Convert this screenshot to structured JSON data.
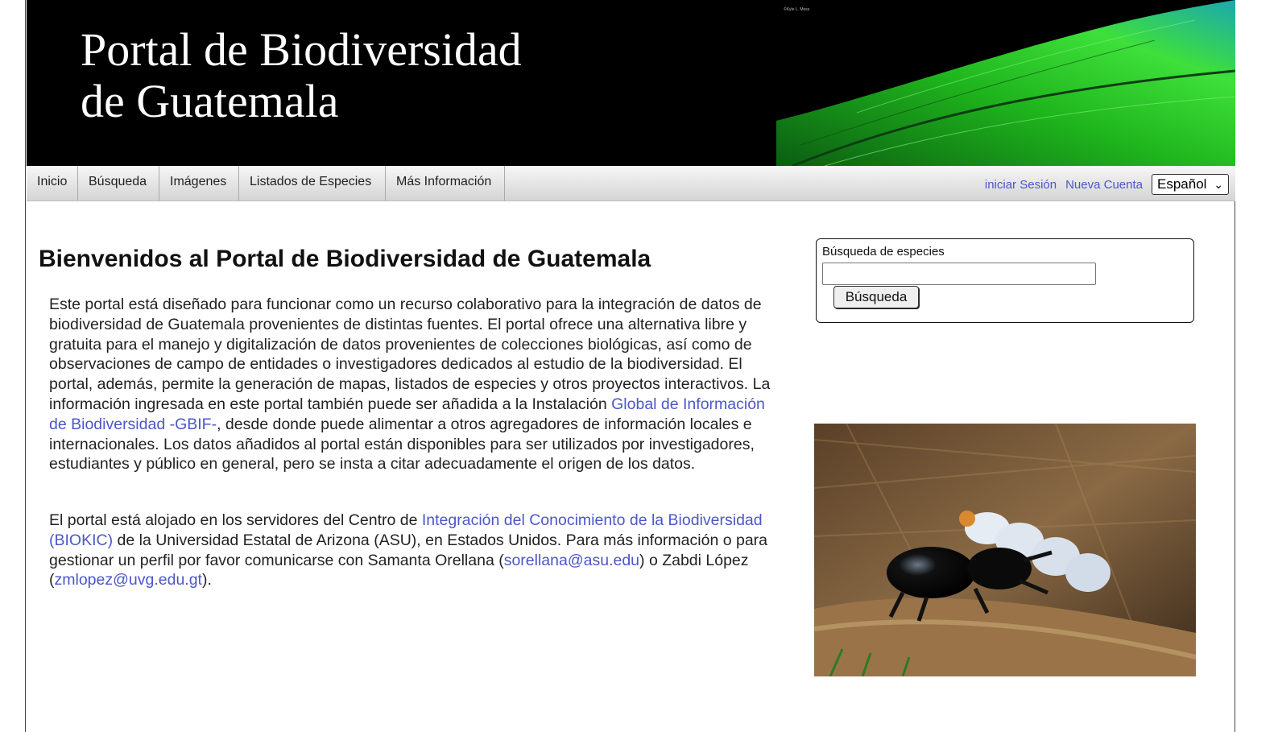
{
  "banner": {
    "title_line1": "Portal de Biodiversidad",
    "title_line2": "de Guatemala",
    "credit": "©Kyle L. Moss"
  },
  "nav": {
    "items": [
      {
        "label": "Inicio"
      },
      {
        "label": "Búsqueda"
      },
      {
        "label": "Imágenes"
      },
      {
        "label": "Listados de Especies"
      },
      {
        "label": "Más Información"
      }
    ],
    "login": "iniciar Sesión",
    "register": "Nueva Cuenta",
    "language": "Español"
  },
  "main": {
    "heading": "Bienvenidos al Portal de Biodiversidad de Guatemala",
    "p1_text_a": "Este portal está diseñado para funcionar como un recurso colaborativo para la integración de datos de biodiversidad de Guatemala provenientes de distintas fuentes. El portal ofrece una alternativa libre y gratuita para el manejo y digitalización de datos provenientes de colecciones biológicas, así como de observaciones de campo de entidades o investigadores dedicados al estudio de la biodiversidad. El portal, además, permite la generación de mapas, listados de especies y otros proyectos interactivos. La información ingresada en este portal también puede ser añadida a la Instalación ",
    "p1_link": "Global de Información de Biodiversidad -GBIF-",
    "p1_text_b": ", desde donde puede alimentar a otros agregadores de información locales e internacionales. Los datos añadidos al portal están disponibles para ser utilizados por investigadores, estudiantes y público en general, pero se insta a citar adecuadamente el origen de los datos.",
    "p2_text_a": "El portal está alojado en los servidores del Centro de ",
    "p2_link": "Integración del Conocimiento de la Biodiversidad (BIOKIC)",
    "p2_text_b": " de la Universidad Estatal de Arizona (ASU), en Estados Unidos. Para más información o para gestionar un perfil por favor comunicarse con Samanta Orellana (",
    "email1": "sorellana@asu.edu",
    "p2_text_c": ") o Zabdi López (",
    "email2": "zmlopez@uvg.edu.gt",
    "p2_text_d": ")."
  },
  "search": {
    "label": "Búsqueda de especies",
    "value": "",
    "button": "Búsqueda"
  },
  "colors": {
    "link": "#4c57c5",
    "banner_bg": "#000000",
    "feather_green": "#2fd12a"
  },
  "icons": {
    "language_dropdown": "chevron-down-icon"
  }
}
